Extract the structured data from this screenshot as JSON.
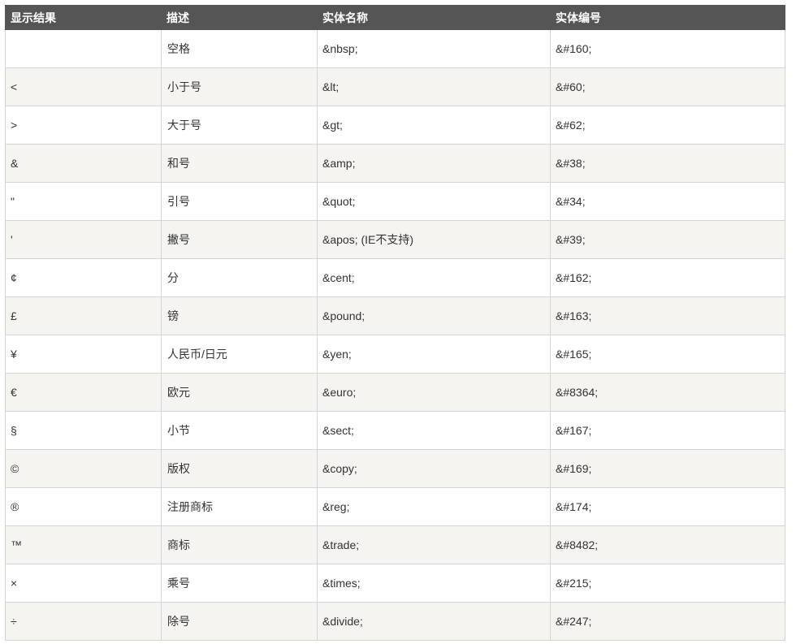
{
  "table": {
    "headers": [
      "显示结果",
      "描述",
      "实体名称",
      "实体编号"
    ],
    "rows": [
      {
        "result": "",
        "desc": "空格",
        "name": "&nbsp;",
        "number": "&#160;"
      },
      {
        "result": "<",
        "desc": "小于号",
        "name": "&lt;",
        "number": "&#60;"
      },
      {
        "result": ">",
        "desc": "大于号",
        "name": "&gt;",
        "number": "&#62;"
      },
      {
        "result": "&",
        "desc": "和号",
        "name": "&amp;",
        "number": "&#38;"
      },
      {
        "result": "\"",
        "desc": "引号",
        "name": "&quot;",
        "number": "&#34;"
      },
      {
        "result": "'",
        "desc": "撇号",
        "name": "&apos; (IE不支持)",
        "number": "&#39;"
      },
      {
        "result": "¢",
        "desc": "分",
        "name": "&cent;",
        "number": "&#162;"
      },
      {
        "result": "£",
        "desc": "镑",
        "name": "&pound;",
        "number": "&#163;"
      },
      {
        "result": "¥",
        "desc": "人民币/日元",
        "name": "&yen;",
        "number": "&#165;"
      },
      {
        "result": "€",
        "desc": "欧元",
        "name": "&euro;",
        "number": "&#8364;"
      },
      {
        "result": "§",
        "desc": "小节",
        "name": "&sect;",
        "number": "&#167;"
      },
      {
        "result": "©",
        "desc": "版权",
        "name": "&copy;",
        "number": "&#169;"
      },
      {
        "result": "®",
        "desc": "注册商标",
        "name": "&reg;",
        "number": "&#174;"
      },
      {
        "result": "™",
        "desc": "商标",
        "name": "&trade;",
        "number": "&#8482;"
      },
      {
        "result": "×",
        "desc": "乘号",
        "name": "&times;",
        "number": "&#215;"
      },
      {
        "result": "÷",
        "desc": "除号",
        "name": "&divide;",
        "number": "&#247;"
      }
    ]
  }
}
